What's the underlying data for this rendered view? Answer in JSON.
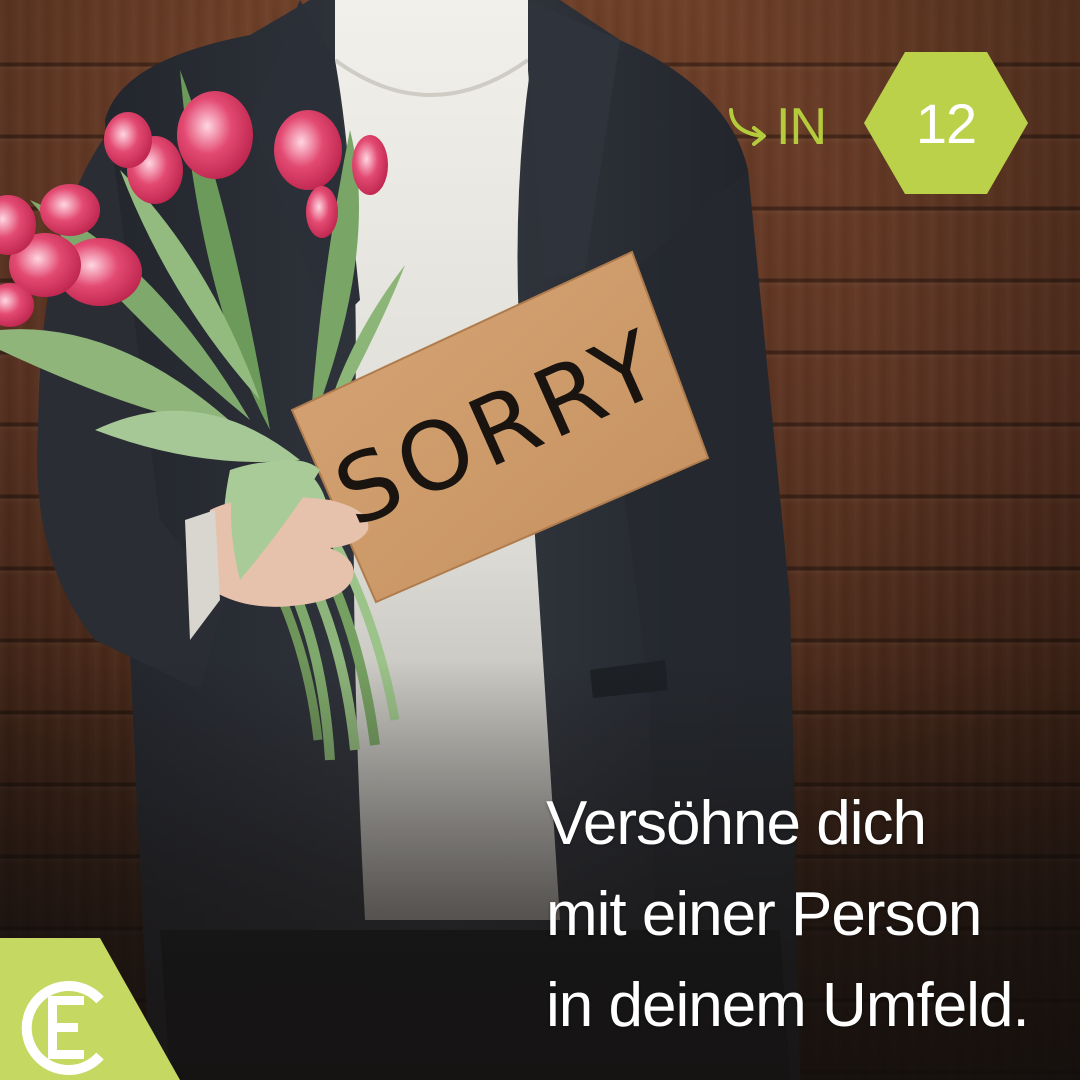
{
  "sign": {
    "text": "SORRY"
  },
  "counter": {
    "label": "IN",
    "number": "12"
  },
  "headline": {
    "line1": "Versöhne dich",
    "line2": "mit einer Person",
    "line3": "in deinem Umfeld."
  },
  "logo": {
    "letter": "E"
  },
  "icons": {
    "counter_arrow": "curved-arrow-icon",
    "brand": "brand-logo-e-icon"
  },
  "colors": {
    "accent_green": "#b4cc3c",
    "hexagon_fill": "#bcd14a",
    "logo_fill": "#c5d861",
    "headline_text": "#ffffff"
  }
}
